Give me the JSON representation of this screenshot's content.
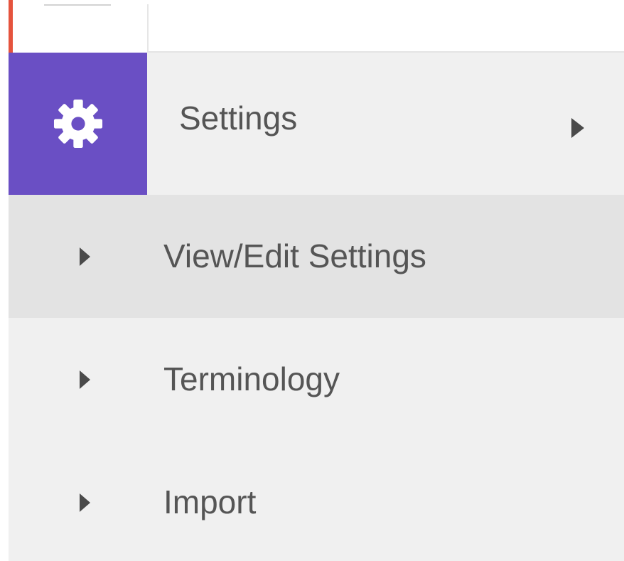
{
  "menu": {
    "header": {
      "icon": "gear-icon",
      "label": "Settings",
      "expand_icon": "triangle-right-icon"
    },
    "items": [
      {
        "label": "View/Edit Settings",
        "icon": "triangle-right-icon",
        "active": true
      },
      {
        "label": "Terminology",
        "icon": "triangle-right-icon",
        "active": false
      },
      {
        "label": "Import",
        "icon": "triangle-right-icon",
        "active": false
      }
    ]
  },
  "colors": {
    "icon_tile": "#6a4fc4",
    "accent": "#e5533d",
    "menu_bg": "#f0f0f0",
    "active_bg": "#e3e3e3",
    "text": "#555555"
  }
}
